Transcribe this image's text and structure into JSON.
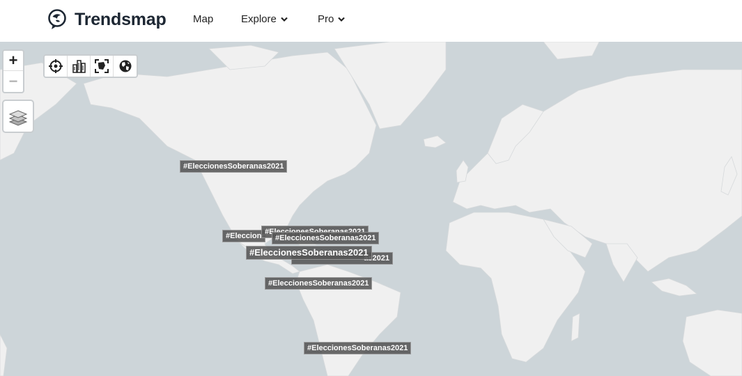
{
  "header": {
    "brand": "Trendsmap",
    "nav": [
      {
        "label": "Map"
      },
      {
        "label": "Explore"
      },
      {
        "label": "Pro"
      }
    ]
  },
  "map_controls": {
    "zoom_in": "+",
    "zoom_out": "−"
  },
  "trends": [
    {
      "text": "#EleccionesSoberanas2021"
    },
    {
      "text": "#Elecciones"
    },
    {
      "text": "#EleccionesSoberanas2021"
    },
    {
      "text": "#EleccionesSoberanas2021"
    },
    {
      "text": "#EleccionesSoberanas2021"
    },
    {
      "text": "as2021"
    },
    {
      "text": "#EleccionesSoberanas2021"
    },
    {
      "text": "#EleccionesSoberanas2021"
    }
  ],
  "colors": {
    "ocean": "#cdd5d9",
    "land": "#f0f0f0",
    "tag_bg": "#555555",
    "brand_text": "#1d2733"
  }
}
